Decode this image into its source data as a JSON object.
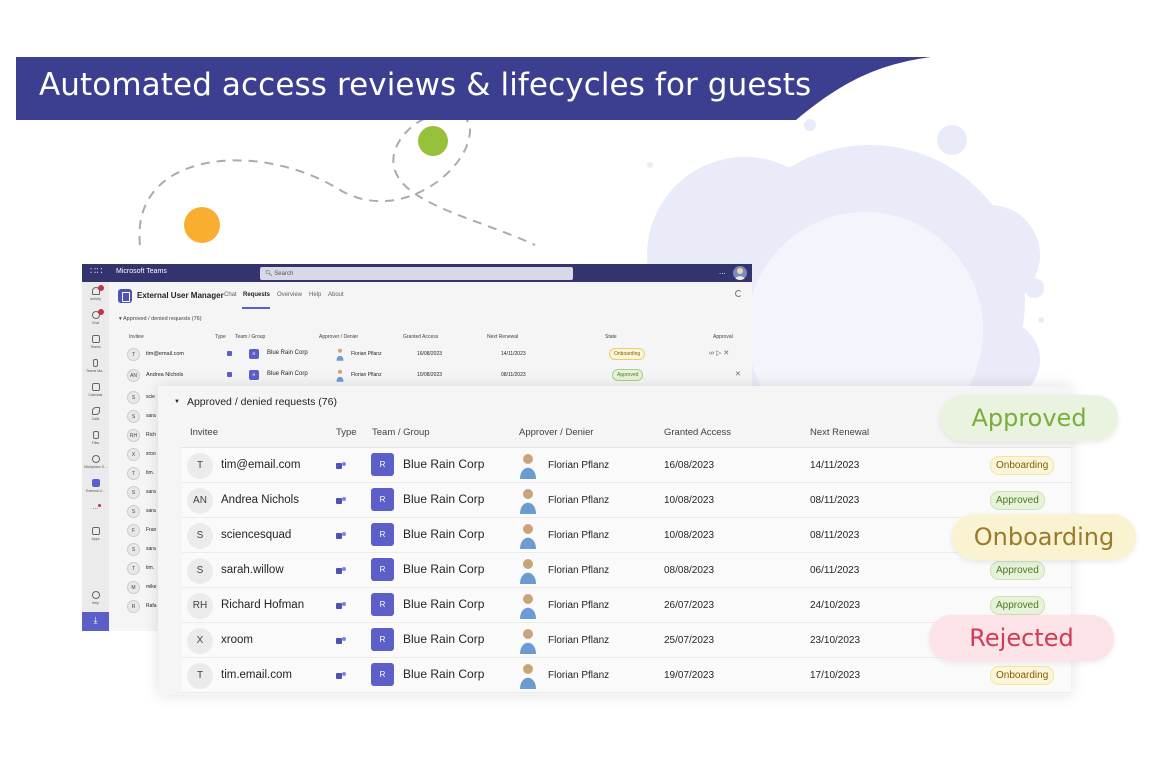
{
  "banner": {
    "title": "Automated access reviews & lifecycles for guests"
  },
  "colors": {
    "banner": "#3c3f8f",
    "accent": "#5b5fc7",
    "orange_dot": "#f9ae2f",
    "green_dot": "#97c13a",
    "cloud": "#e9ebf8"
  },
  "teams": {
    "app_name": "Microsoft Teams",
    "search_placeholder": "Search",
    "more": "...",
    "rail": [
      {
        "label": "Activity",
        "icon": "bell-icon"
      },
      {
        "label": "Chat",
        "icon": "chat-icon"
      },
      {
        "label": "Teams",
        "icon": "teams-icon"
      },
      {
        "label": "Teams Ma...",
        "icon": "teams-manager-icon"
      },
      {
        "label": "Calendar",
        "icon": "calendar-icon"
      },
      {
        "label": "Calls",
        "icon": "phone-icon"
      },
      {
        "label": "Files",
        "icon": "file-icon"
      },
      {
        "label": "Workplace S...",
        "icon": "workplace-icon"
      },
      {
        "label": "External U...",
        "icon": "external-user-icon"
      },
      {
        "label": "...",
        "icon": "more-icon"
      },
      {
        "label": "Apps",
        "icon": "apps-icon"
      },
      {
        "label": "Help",
        "icon": "help-icon"
      }
    ],
    "app": {
      "title": "External User Manager",
      "tabs": [
        "Chat",
        "Requests",
        "Overview",
        "Help",
        "About"
      ]
    },
    "section_title": "Approved / denied requests (76)",
    "columns": [
      "Invitee",
      "Type",
      "Team / Group",
      "Approver / Denier",
      "Granted Access",
      "Next Renewal",
      "State",
      "Approval"
    ],
    "rows": [
      {
        "initials": "T",
        "name": "tim@email.com",
        "team_initial": "R",
        "team": "Blue Rain Corp",
        "approver": "Florian Pflanz",
        "granted": "16/08/2023",
        "renewal": "14/11/2023",
        "state": "Onboarding"
      },
      {
        "initials": "AN",
        "name": "Andrea Nichols",
        "team_initial": "R",
        "team": "Blue Rain Corp",
        "approver": "Florian Pflanz",
        "granted": "10/08/2023",
        "renewal": "08/11/2023",
        "state": "Approved"
      }
    ],
    "dim_rows": [
      {
        "initials": "S",
        "name": "scie"
      },
      {
        "initials": "S",
        "name": "sara"
      },
      {
        "initials": "RH",
        "name": "Rich"
      },
      {
        "initials": "X",
        "name": "xroo"
      },
      {
        "initials": "T",
        "name": "tim."
      },
      {
        "initials": "S",
        "name": "sara"
      },
      {
        "initials": "S",
        "name": "sara"
      },
      {
        "initials": "F",
        "name": "Fran"
      },
      {
        "initials": "S",
        "name": "sara"
      },
      {
        "initials": "T",
        "name": "tim."
      },
      {
        "initials": "M",
        "name": "mike"
      },
      {
        "initials": "R",
        "name": "Rafa"
      }
    ]
  },
  "front": {
    "section_title": "Approved / denied requests (76)",
    "columns": [
      "Invitee",
      "Type",
      "Team / Group",
      "Approver / Denier",
      "Granted Access",
      "Next Renewal"
    ],
    "rows": [
      {
        "initials": "T",
        "name": "tim@email.com",
        "team_initial": "R",
        "team": "Blue Rain Corp",
        "approver": "Florian Pflanz",
        "granted": "16/08/2023",
        "renewal": "14/11/2023",
        "state": "Onboarding"
      },
      {
        "initials": "AN",
        "name": "Andrea Nichols",
        "team_initial": "R",
        "team": "Blue Rain Corp",
        "approver": "Florian Pflanz",
        "granted": "10/08/2023",
        "renewal": "08/11/2023",
        "state": "Approved"
      },
      {
        "initials": "S",
        "name": "sciencesquad",
        "team_initial": "R",
        "team": "Blue Rain Corp",
        "approver": "Florian Pflanz",
        "granted": "10/08/2023",
        "renewal": "08/11/2023",
        "state": ""
      },
      {
        "initials": "S",
        "name": "sarah.willow",
        "team_initial": "R",
        "team": "Blue Rain Corp",
        "approver": "Florian Pflanz",
        "granted": "08/08/2023",
        "renewal": "06/11/2023",
        "state": "Approved"
      },
      {
        "initials": "RH",
        "name": "Richard Hofman",
        "team_initial": "R",
        "team": "Blue Rain Corp",
        "approver": "Florian Pflanz",
        "granted": "26/07/2023",
        "renewal": "24/10/2023",
        "state": "Approved"
      },
      {
        "initials": "X",
        "name": "xroom",
        "team_initial": "R",
        "team": "Blue Rain Corp",
        "approver": "Florian Pflanz",
        "granted": "25/07/2023",
        "renewal": "23/10/2023",
        "state": ""
      },
      {
        "initials": "T",
        "name": "tim.email.com",
        "team_initial": "R",
        "team": "Blue Rain Corp",
        "approver": "Florian Pflanz",
        "granted": "19/07/2023",
        "renewal": "17/10/2023",
        "state": "Onboarding"
      }
    ]
  },
  "callouts": {
    "approved": "Approved",
    "onboarding": "Onboarding",
    "rejected": "Rejected"
  }
}
